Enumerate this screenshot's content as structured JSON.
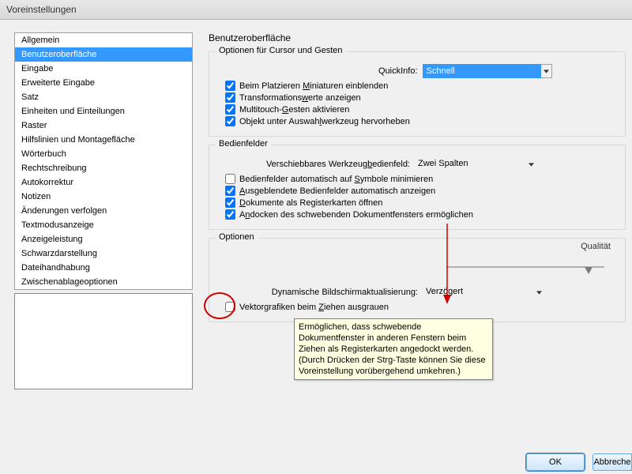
{
  "title": "Voreinstellungen",
  "sidebar": {
    "items": [
      {
        "label": "Allgemein"
      },
      {
        "label": "Benutzeroberfläche",
        "selected": true
      },
      {
        "label": "Eingabe"
      },
      {
        "label": "Erweiterte Eingabe"
      },
      {
        "label": "Satz"
      },
      {
        "label": "Einheiten und Einteilungen"
      },
      {
        "label": "Raster"
      },
      {
        "label": "Hilfslinien und Montagefläche"
      },
      {
        "label": "Wörterbuch"
      },
      {
        "label": "Rechtschreibung"
      },
      {
        "label": "Autokorrektur"
      },
      {
        "label": "Notizen"
      },
      {
        "label": "Änderungen verfolgen"
      },
      {
        "label": "Textmodusanzeige"
      },
      {
        "label": "Anzeigeleistung"
      },
      {
        "label": "Schwarzdarstellung"
      },
      {
        "label": "Dateihandhabung"
      },
      {
        "label": "Zwischenablageoptionen"
      }
    ]
  },
  "page": {
    "title": "Benutzeroberfläche",
    "group_cursor": {
      "legend": "Optionen für Cursor und Gesten",
      "quickinfo_label": "QuickInfo:",
      "quickinfo_value": "Schnell",
      "chk_miniaturen": {
        "checked": true,
        "pre": "Beim Platzieren ",
        "u": "M",
        "post": "iniaturen einblenden"
      },
      "chk_transform": {
        "checked": true,
        "pre": "Transformations",
        "u": "w",
        "post": "erte anzeigen"
      },
      "chk_multitouch": {
        "checked": true,
        "pre": "Multitouch-",
        "u": "G",
        "post": "esten aktivieren"
      },
      "chk_auswahl": {
        "checked": true,
        "pre": "Objekt unter Auswah",
        "u": "l",
        "post": "werkzeug hervorheben"
      }
    },
    "group_bedien": {
      "legend": "Bedienfelder",
      "werkzeug_label": "Verschiebbares Werkzeugbedienfeld:",
      "werkzeug_value": "Zwei Spalten",
      "chk_symbole": {
        "checked": false,
        "pre": "Bedienfelder automatisch auf ",
        "u": "S",
        "post": "ymbole minimieren"
      },
      "chk_ausgeblen": {
        "checked": true,
        "pre": "",
        "u": "A",
        "post": "usgeblendete Bedienfelder automatisch anzeigen"
      },
      "chk_register": {
        "checked": true,
        "pre": "",
        "u": "D",
        "post": "okumente als Registerkarten öffnen"
      },
      "chk_andocken": {
        "checked": true,
        "pre": "A",
        "u": "n",
        "post": "docken des schwebenden Dokumentfensters ermöglichen"
      }
    },
    "group_optionen": {
      "legend": "Optionen",
      "slider_right": "Qualität",
      "dyn_label": "Dynamische Bildschirmaktualisierung:",
      "dyn_value": "Verzögert",
      "chk_vektor": {
        "checked": false,
        "pre": "Vektorgrafiken beim ",
        "u": "Z",
        "post": "iehen ausgrauen"
      }
    },
    "tooltip": "Ermöglichen, dass schwebende Dokumentfenster in anderen Fenstern beim Ziehen als Registerkarten angedockt werden. (Durch Drücken der Strg-Taste können Sie diese Voreinstellung vorübergehend umkehren.)"
  },
  "buttons": {
    "ok": "OK",
    "cancel": "Abbreche"
  }
}
